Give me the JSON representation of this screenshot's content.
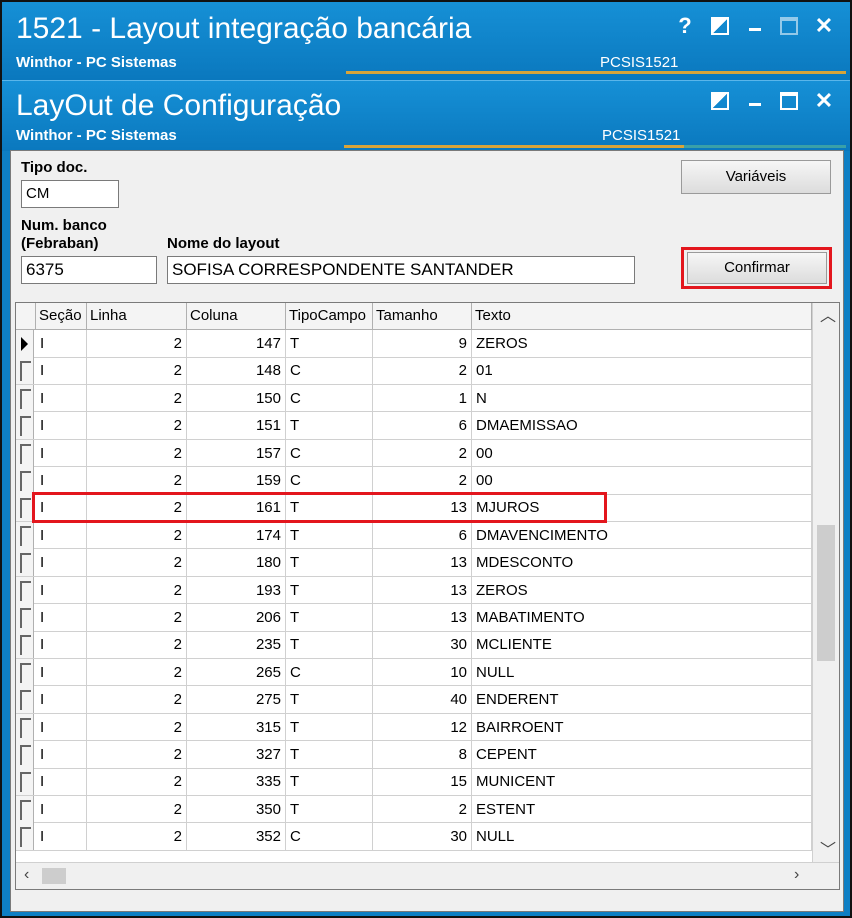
{
  "window1": {
    "title": "1521 - Layout integração bancária",
    "subtitle": "Winthor - PC Sistemas",
    "code": "PCSIS1521",
    "help_glyph": "?"
  },
  "window2": {
    "title": "LayOut de Configuração",
    "subtitle": "Winthor - PC Sistemas",
    "code": "PCSIS1521"
  },
  "form": {
    "tipo_doc_label": "Tipo doc.",
    "tipo_doc_value": "CM",
    "num_banco_label_1": "Num. banco",
    "num_banco_label_2": "(Febraban)",
    "num_banco_value": "6375",
    "nome_layout_label": "Nome do layout",
    "nome_layout_value": "SOFISA CORRESPONDENTE SANTANDER",
    "variaveis_button": "Variáveis",
    "confirmar_button": "Confirmar"
  },
  "grid": {
    "columns": [
      "Seção",
      "Linha",
      "Coluna",
      "TipoCampo",
      "Tamanho",
      "Texto"
    ],
    "rows": [
      [
        "I",
        "2",
        "147",
        "T",
        "9",
        "ZEROS"
      ],
      [
        "I",
        "2",
        "148",
        "C",
        "2",
        "01"
      ],
      [
        "I",
        "2",
        "150",
        "C",
        "1",
        "N"
      ],
      [
        "I",
        "2",
        "151",
        "T",
        "6",
        "DMAEMISSAO"
      ],
      [
        "I",
        "2",
        "157",
        "C",
        "2",
        "00"
      ],
      [
        "I",
        "2",
        "159",
        "C",
        "2",
        "00"
      ],
      [
        "I",
        "2",
        "161",
        "T",
        "13",
        "MJUROS"
      ],
      [
        "I",
        "2",
        "174",
        "T",
        "6",
        "DMAVENCIMENTO"
      ],
      [
        "I",
        "2",
        "180",
        "T",
        "13",
        "MDESCONTO"
      ],
      [
        "I",
        "2",
        "193",
        "T",
        "13",
        "ZEROS"
      ],
      [
        "I",
        "2",
        "206",
        "T",
        "13",
        "MABATIMENTO"
      ],
      [
        "I",
        "2",
        "235",
        "T",
        "30",
        "MCLIENTE"
      ],
      [
        "I",
        "2",
        "265",
        "C",
        "10",
        "NULL"
      ],
      [
        "I",
        "2",
        "275",
        "T",
        "40",
        "ENDERENT"
      ],
      [
        "I",
        "2",
        "315",
        "T",
        "12",
        "BAIRROENT"
      ],
      [
        "I",
        "2",
        "327",
        "T",
        "8",
        "CEPENT"
      ],
      [
        "I",
        "2",
        "335",
        "T",
        "15",
        "MUNICENT"
      ],
      [
        "I",
        "2",
        "350",
        "T",
        "2",
        "ESTENT"
      ],
      [
        "I",
        "2",
        "352",
        "C",
        "30",
        "NULL"
      ]
    ],
    "selected_row_index": 0,
    "highlighted_row_index": 6
  },
  "colors": {
    "titlebar": "#0e7fc4",
    "highlight": "#e3161d",
    "accent_line": "#d8a43a"
  },
  "icons": {
    "help": "help-icon",
    "restore": "restore-icon",
    "minimize": "minimize-icon",
    "maximize": "maximize-icon",
    "close": "close-icon",
    "row_pointer": "row-pointer-icon",
    "scroll_up": "chevron-up-icon",
    "scroll_down": "chevron-down-icon",
    "scroll_left": "chevron-left-icon",
    "scroll_right": "chevron-right-icon"
  }
}
